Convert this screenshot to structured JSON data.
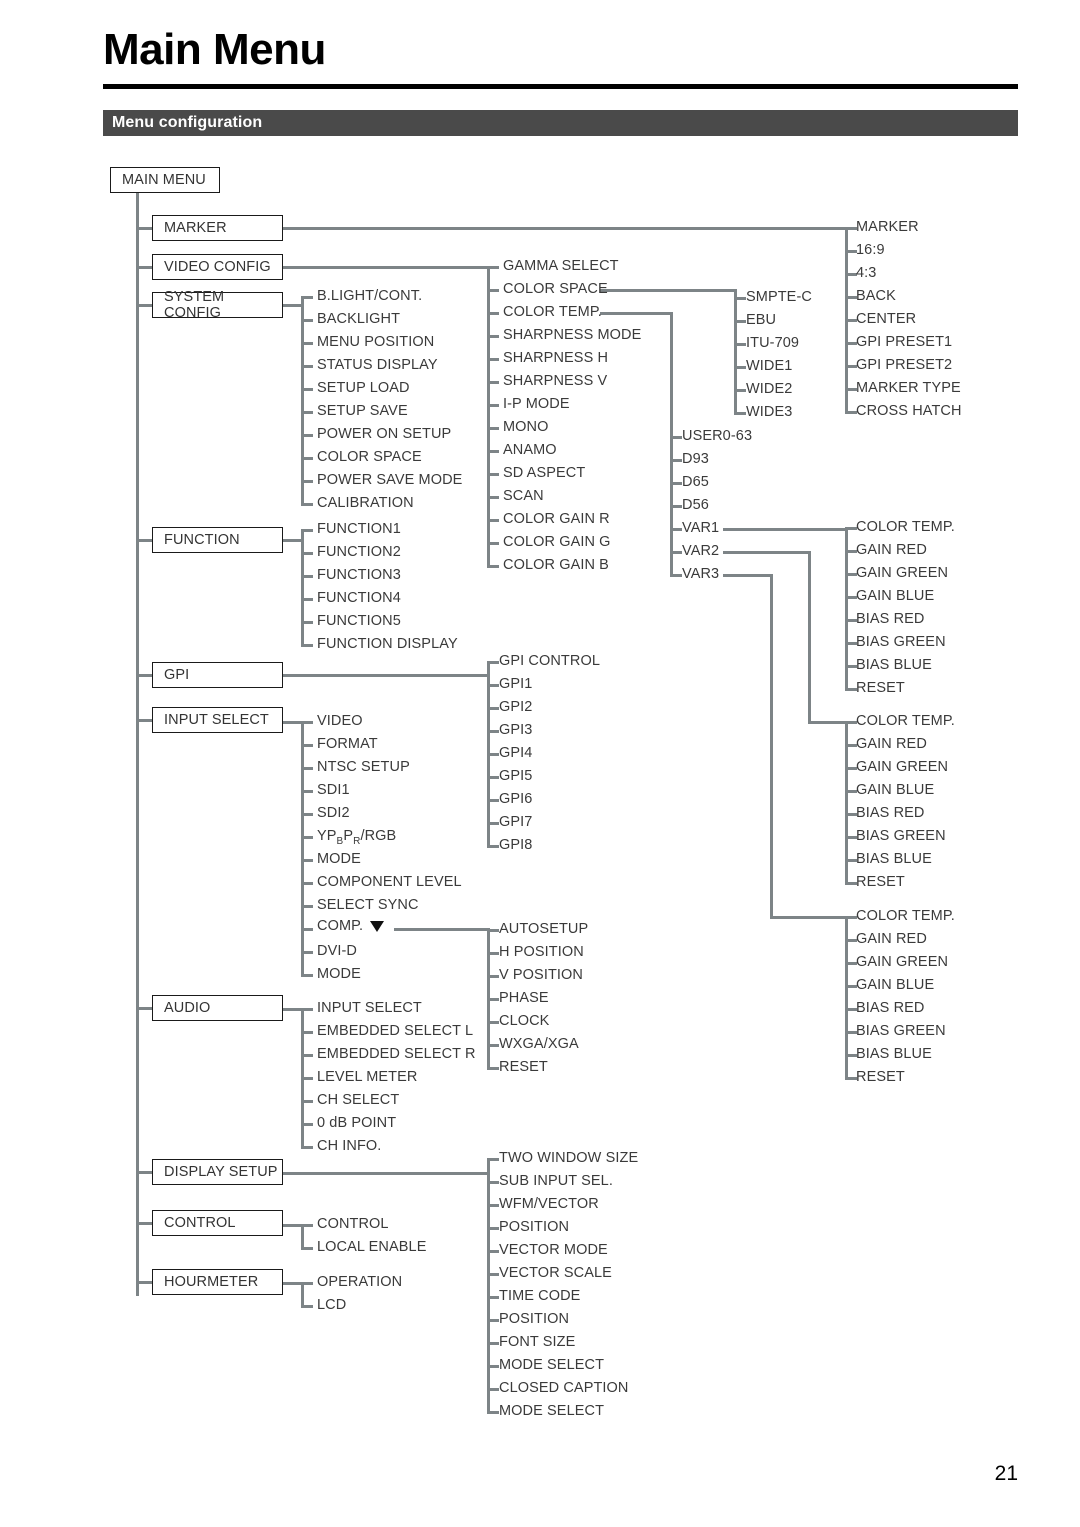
{
  "page": {
    "title": "Main Menu",
    "section_heading": "Menu configuration",
    "page_number": "21",
    "accent_bar_color": "#4a4a4a",
    "line_color": "#7d8487",
    "box_border_color": "#1a1a1a"
  },
  "tree": {
    "root": "MAIN MENU",
    "level1": [
      {
        "label": "MARKER"
      },
      {
        "label": "VIDEO CONFIG"
      },
      {
        "label": "SYSTEM CONFIG"
      },
      {
        "label": "FUNCTION"
      },
      {
        "label": "GPI"
      },
      {
        "label": "INPUT SELECT"
      },
      {
        "label": "AUDIO"
      },
      {
        "label": "DISPLAY SETUP"
      },
      {
        "label": "CONTROL"
      },
      {
        "label": "HOURMETER"
      }
    ],
    "marker_items": [
      "MARKER",
      "16:9",
      "4:3",
      "BACK",
      "CENTER",
      "GPI PRESET1",
      "GPI PRESET2",
      "MARKER TYPE",
      "CROSS HATCH"
    ],
    "video_config_items": [
      "GAMMA SELECT",
      "COLOR SPACE",
      "COLOR TEMP.",
      "SHARPNESS MODE",
      "SHARPNESS H",
      "SHARPNESS V",
      "I-P MODE",
      "MONO",
      "ANAMO",
      "SD ASPECT",
      "SCAN",
      "COLOR GAIN R",
      "COLOR GAIN G",
      "COLOR GAIN B"
    ],
    "color_space_items": [
      "SMPTE-C",
      "EBU",
      "ITU-709",
      "WIDE1",
      "WIDE2",
      "WIDE3"
    ],
    "color_temp_items": [
      "USER0-63",
      "D93",
      "D65",
      "D56",
      "VAR1",
      "VAR2",
      "VAR3"
    ],
    "var_detail_items": [
      "COLOR TEMP.",
      "GAIN RED",
      "GAIN GREEN",
      "GAIN BLUE",
      "BIAS RED",
      "BIAS GREEN",
      "BIAS BLUE",
      "RESET"
    ],
    "system_config_items": [
      "B.LIGHT/CONT.",
      "BACKLIGHT",
      "MENU POSITION",
      "STATUS DISPLAY",
      "SETUP LOAD",
      "SETUP SAVE",
      "POWER ON SETUP",
      "COLOR SPACE",
      "POWER SAVE MODE",
      "CALIBRATION"
    ],
    "function_items": [
      "FUNCTION1",
      "FUNCTION2",
      "FUNCTION3",
      "FUNCTION4",
      "FUNCTION5",
      "FUNCTION DISPLAY"
    ],
    "gpi_items": [
      "GPI CONTROL",
      "GPI1",
      "GPI2",
      "GPI3",
      "GPI4",
      "GPI5",
      "GPI6",
      "GPI7",
      "GPI8"
    ],
    "input_select_items": [
      "VIDEO",
      "FORMAT",
      "NTSC SETUP",
      "SDI1",
      "SDI2",
      "YPBPR/RGB",
      "MODE",
      "COMPONENT LEVEL",
      "SELECT SYNC",
      "COMP.",
      "DVI-D",
      "MODE"
    ],
    "input_select_ypbpr": {
      "prefix": "YP",
      "sub1": "B",
      "mid": "P",
      "sub2": "R",
      "suffix": "/RGB"
    },
    "comp_sub_items": [
      "AUTOSETUP",
      "H POSITION",
      "V POSITION",
      "PHASE",
      "CLOCK",
      "WXGA/XGA",
      "RESET"
    ],
    "audio_items": [
      "INPUT SELECT",
      "EMBEDDED SELECT L",
      "EMBEDDED SELECT R",
      "LEVEL METER",
      "CH SELECT",
      "0 dB POINT",
      "CH INFO."
    ],
    "display_setup_items": [
      "TWO WINDOW SIZE",
      "SUB INPUT SEL.",
      "WFM/VECTOR",
      "POSITION",
      "VECTOR MODE",
      "VECTOR SCALE",
      "TIME CODE",
      "POSITION",
      "FONT SIZE",
      "MODE SELECT",
      "CLOSED CAPTION",
      "MODE SELECT"
    ],
    "control_items": [
      "CONTROL",
      "LOCAL ENABLE"
    ],
    "hourmeter_items": [
      "OPERATION",
      "LCD"
    ]
  }
}
